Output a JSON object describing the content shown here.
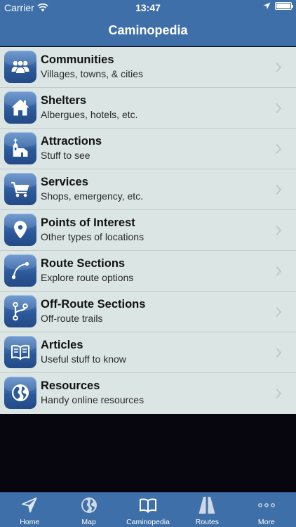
{
  "status_bar": {
    "carrier": "Carrier",
    "time": "13:47",
    "battery_level": 1.0
  },
  "nav": {
    "title": "Caminopedia"
  },
  "menu": {
    "items": [
      {
        "title": "Communities",
        "subtitle": "Villages, towns, & cities",
        "icon": "people-icon"
      },
      {
        "title": "Shelters",
        "subtitle": "Albergues, hotels, etc.",
        "icon": "house-icon"
      },
      {
        "title": "Attractions",
        "subtitle": "Stuff to see",
        "icon": "church-icon"
      },
      {
        "title": "Services",
        "subtitle": "Shops, emergency, etc.",
        "icon": "cart-icon"
      },
      {
        "title": "Points of Interest",
        "subtitle": "Other types of locations",
        "icon": "location-pin-icon"
      },
      {
        "title": "Route Sections",
        "subtitle": "Explore route options",
        "icon": "route-curve-icon"
      },
      {
        "title": "Off-Route Sections",
        "subtitle": "Off-route trails",
        "icon": "branch-icon"
      },
      {
        "title": "Articles",
        "subtitle": "Useful stuff to know",
        "icon": "book-icon"
      },
      {
        "title": "Resources",
        "subtitle": "Handy online resources",
        "icon": "globe-icon"
      }
    ]
  },
  "tabs": [
    {
      "label": "Home",
      "icon": "navigation-arrow-icon"
    },
    {
      "label": "Map",
      "icon": "globe-icon"
    },
    {
      "label": "Caminopedia",
      "icon": "book-icon",
      "selected": true
    },
    {
      "label": "Routes",
      "icon": "road-icon"
    },
    {
      "label": "More",
      "icon": "more-dots-icon"
    }
  ],
  "colors": {
    "bar": "#3f6fa8",
    "list_background": "#dbe5e3",
    "empty_area": "#07060f"
  }
}
